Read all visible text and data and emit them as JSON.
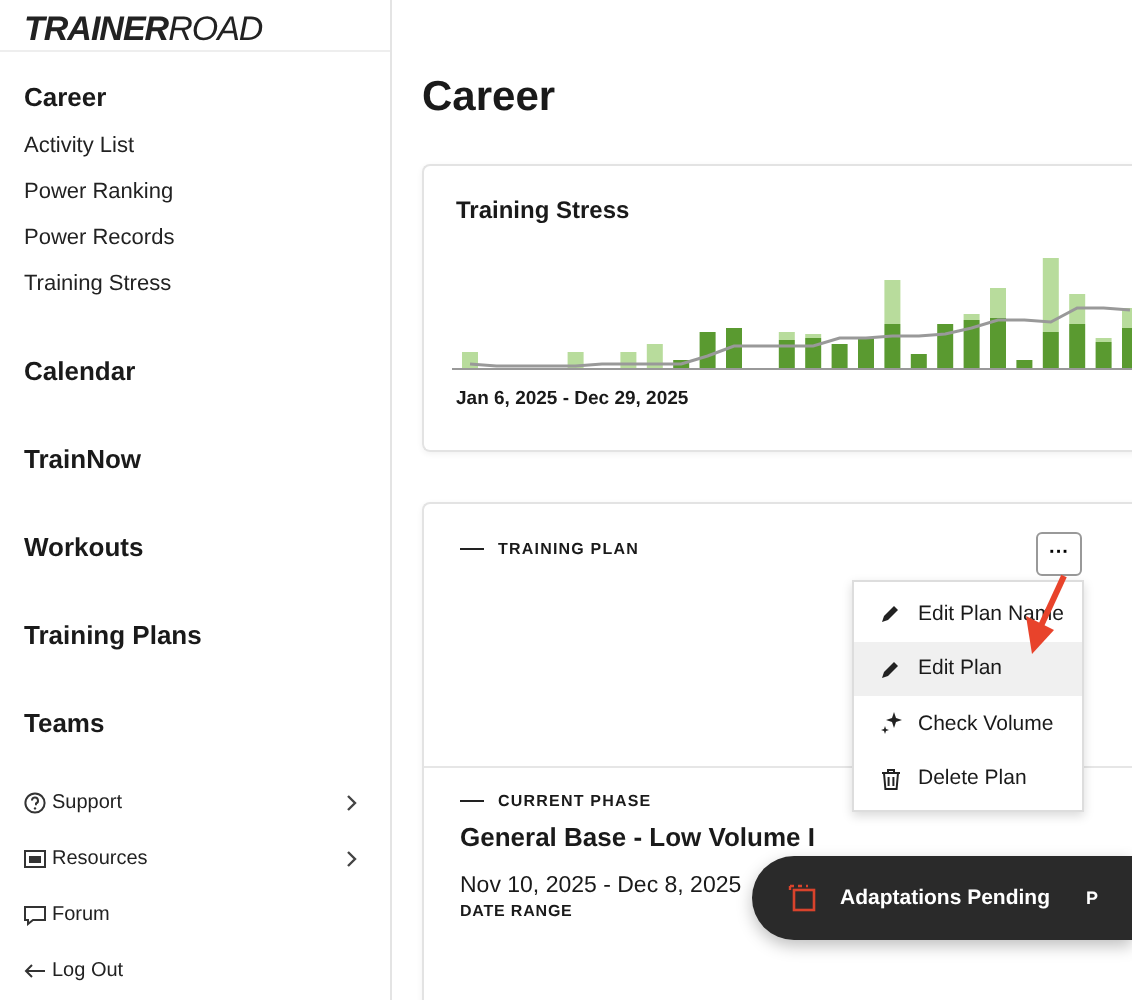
{
  "logo": {
    "bold": "TRAINER",
    "light": "ROAD"
  },
  "sidebar": {
    "items": [
      {
        "kind": "section",
        "label": "Career",
        "children": [
          {
            "label": "Activity List"
          },
          {
            "label": "Power Ranking"
          },
          {
            "label": "Power Records"
          },
          {
            "label": "Training Stress"
          }
        ]
      },
      {
        "kind": "section",
        "label": "Calendar"
      },
      {
        "kind": "section",
        "label": "TrainNow"
      },
      {
        "kind": "section",
        "label": "Workouts"
      },
      {
        "kind": "section",
        "label": "Training Plans"
      },
      {
        "kind": "section",
        "label": "Teams"
      },
      {
        "kind": "footer",
        "label": "Support",
        "expandable": true
      },
      {
        "kind": "footer",
        "label": "Resources",
        "expandable": true
      },
      {
        "kind": "footer",
        "label": "Forum",
        "expandable": false
      },
      {
        "kind": "footer",
        "label": "Log Out",
        "expandable": false
      }
    ]
  },
  "page_title": "Career",
  "stress_card": {
    "title": "Training Stress",
    "date_range": "Jan 6, 2025 - Dec 29, 2025"
  },
  "plan_card": {
    "label": "TRAINING PLAN",
    "more_button": "···",
    "menu": [
      {
        "label": "Edit Plan Name",
        "selected": false
      },
      {
        "label": "Edit Plan",
        "selected": true
      },
      {
        "label": "Check Volume",
        "selected": false
      },
      {
        "label": "Delete Plan",
        "selected": false
      }
    ],
    "phase_label": "CURRENT PHASE",
    "phase_name": "General Base - Low Volume I",
    "dates": "Nov 10, 2025 - Dec 8, 2025",
    "dates_label": "DATE RANGE"
  },
  "toast": {
    "text": "Adaptations Pending",
    "cut_text": "P"
  }
}
